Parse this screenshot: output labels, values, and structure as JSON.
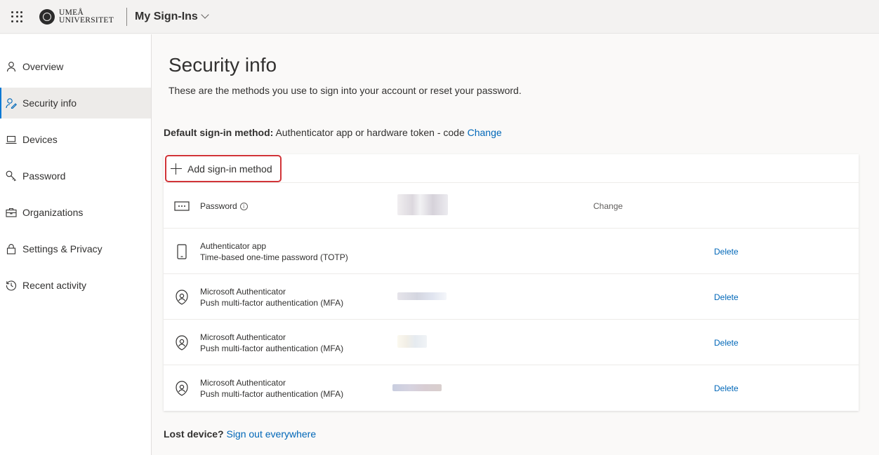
{
  "app": {
    "logo_line1": "UMEÅ",
    "logo_line2": "UNIVERSITET",
    "title": "My Sign-Ins"
  },
  "sidebar": {
    "items": [
      {
        "label": "Overview",
        "icon": "person-icon",
        "active": false
      },
      {
        "label": "Security info",
        "icon": "person-key-icon",
        "active": true
      },
      {
        "label": "Devices",
        "icon": "laptop-icon",
        "active": false
      },
      {
        "label": "Password",
        "icon": "key-icon",
        "active": false
      },
      {
        "label": "Organizations",
        "icon": "briefcase-icon",
        "active": false
      },
      {
        "label": "Settings & Privacy",
        "icon": "lock-icon",
        "active": false
      },
      {
        "label": "Recent activity",
        "icon": "history-icon",
        "active": false
      }
    ]
  },
  "main": {
    "title": "Security info",
    "subtitle": "These are the methods you use to sign into your account or reset your password.",
    "default_label": "Default sign-in method:",
    "default_value": "Authenticator app or hardware token - code",
    "default_change": "Change",
    "add_method": "Add sign-in method",
    "methods": [
      {
        "title": "Password",
        "subtitle": "",
        "action": "Change",
        "icon": "password-dots-icon"
      },
      {
        "title": "Authenticator app",
        "subtitle": "Time-based one-time password (TOTP)",
        "action": "Delete",
        "icon": "phone-icon"
      },
      {
        "title": "Microsoft Authenticator",
        "subtitle": "Push multi-factor authentication (MFA)",
        "action": "Delete",
        "icon": "authenticator-icon"
      },
      {
        "title": "Microsoft Authenticator",
        "subtitle": "Push multi-factor authentication (MFA)",
        "action": "Delete",
        "icon": "authenticator-icon"
      },
      {
        "title": "Microsoft Authenticator",
        "subtitle": "Push multi-factor authentication (MFA)",
        "action": "Delete",
        "icon": "authenticator-icon"
      }
    ],
    "lost_label": "Lost device?",
    "lost_link": "Sign out everywhere"
  },
  "colors": {
    "accent": "#0078d4",
    "link": "#0067b8",
    "highlight_border": "#d13438"
  }
}
